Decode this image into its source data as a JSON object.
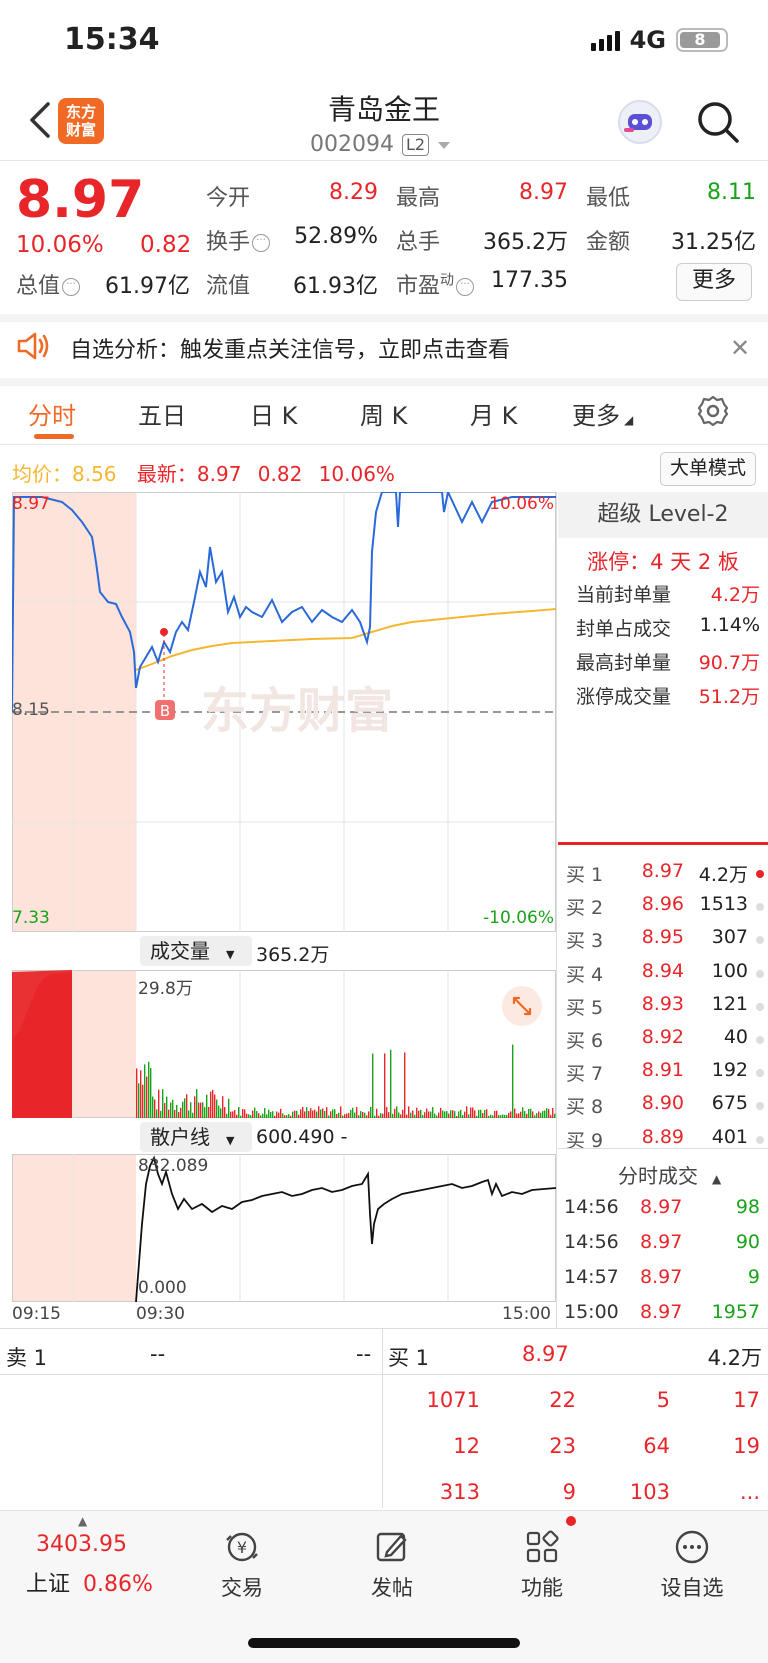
{
  "status_bar": {
    "time": "15:34",
    "network": "4G",
    "battery": "8"
  },
  "header": {
    "logo_text": "东方财富",
    "stock_name": "青岛金王",
    "stock_code": "002094",
    "level_badge": "L2"
  },
  "quote": {
    "price": "8.97",
    "change_pct": "10.06%",
    "change": "0.82",
    "stats": [
      {
        "label": "今开",
        "value": "8.29",
        "color": "red"
      },
      {
        "label": "最高",
        "value": "8.97",
        "color": "red"
      },
      {
        "label": "最低",
        "value": "8.11",
        "color": "green"
      },
      {
        "label": "换手",
        "value": "52.89%",
        "color": "black"
      },
      {
        "label": "总手",
        "value": "365.2万",
        "color": "black"
      },
      {
        "label": "金额",
        "value": "31.25亿",
        "color": "black"
      },
      {
        "label": "总值",
        "value": "61.97亿",
        "color": "black"
      },
      {
        "label": "流值",
        "value": "61.93亿",
        "color": "black"
      },
      {
        "label": "市盈",
        "label_sup": "动",
        "value": "177.35",
        "color": "black"
      }
    ],
    "more_label": "更多"
  },
  "notice": {
    "text": "自选分析：触发重点关注信号，立即点击查看"
  },
  "tabs": [
    "分时",
    "五日",
    "日 K",
    "周 K",
    "月 K",
    "更多"
  ],
  "summary": {
    "avg_label": "均价：",
    "avg_value": "8.56",
    "latest_label": "最新：",
    "latest_value": "8.97",
    "latest_change": "0.82",
    "latest_pct": "10.06%",
    "mode_button": "大单模式"
  },
  "chart": {
    "top_left": "8.97",
    "top_right": "10.06%",
    "mid_left": "8.15",
    "bottom_left": "7.33",
    "bottom_right": "-10.06%",
    "marker": "B",
    "watermark": "东方财富",
    "volume_label": "成交量",
    "volume_value": "365.2万",
    "volume_max": "29.8万",
    "retail_label": "散户线",
    "retail_value": "600.490 -",
    "retail_max": "832.089",
    "retail_min": "0.000",
    "time_axis": [
      "09:15",
      "09:30",
      "15:00"
    ]
  },
  "panel": {
    "title": "超级 Level-2",
    "limit_up": "涨停：4 天 2 板",
    "items": [
      {
        "label": "当前封单量",
        "value": "4.2万"
      },
      {
        "label": "封单占成交",
        "value": "1.14%"
      },
      {
        "label": "最高封单量",
        "value": "90.7万"
      },
      {
        "label": "涨停成交量",
        "value": "51.2万"
      }
    ],
    "bids": [
      {
        "label": "买 1",
        "price": "8.97",
        "vol": "4.2万"
      },
      {
        "label": "买 2",
        "price": "8.96",
        "vol": "1513"
      },
      {
        "label": "买 3",
        "price": "8.95",
        "vol": "307"
      },
      {
        "label": "买 4",
        "price": "8.94",
        "vol": "100"
      },
      {
        "label": "买 5",
        "price": "8.93",
        "vol": "121"
      },
      {
        "label": "买 6",
        "price": "8.92",
        "vol": "40"
      },
      {
        "label": "买 7",
        "price": "8.91",
        "vol": "192"
      },
      {
        "label": "买 8",
        "price": "8.90",
        "vol": "675"
      },
      {
        "label": "买 9",
        "price": "8.89",
        "vol": "401"
      }
    ],
    "trades_title": "分时成交",
    "trades": [
      {
        "time": "14:56",
        "price": "8.97",
        "vol": "98"
      },
      {
        "time": "14:56",
        "price": "8.97",
        "vol": "90"
      },
      {
        "time": "14:57",
        "price": "8.97",
        "vol": "9"
      },
      {
        "time": "15:00",
        "price": "8.97",
        "vol": "1957"
      }
    ]
  },
  "book": {
    "sell_label": "卖 1",
    "sell_price": "--",
    "sell_vol": "--",
    "buy_label": "买 1",
    "buy_price": "8.97",
    "buy_vol": "4.2万",
    "rows": [
      [
        "1071",
        "22",
        "5",
        "17"
      ],
      [
        "12",
        "23",
        "64",
        "19"
      ],
      [
        "313",
        "9",
        "103",
        "..."
      ]
    ]
  },
  "nav": {
    "index_value": "3403.95",
    "index_name": "上证",
    "index_pct": "0.86%",
    "items": [
      {
        "label": "交易",
        "icon": "trade-icon"
      },
      {
        "label": "发帖",
        "icon": "post-icon"
      },
      {
        "label": "功能",
        "icon": "apps-icon"
      },
      {
        "label": "设自选",
        "icon": "more-icon"
      }
    ]
  },
  "colors": {
    "up": "#e8262a",
    "down": "#1aa21a",
    "accent": "#f06a25",
    "price_line": "#2a6ad8",
    "avg_line": "#f5b731"
  }
}
